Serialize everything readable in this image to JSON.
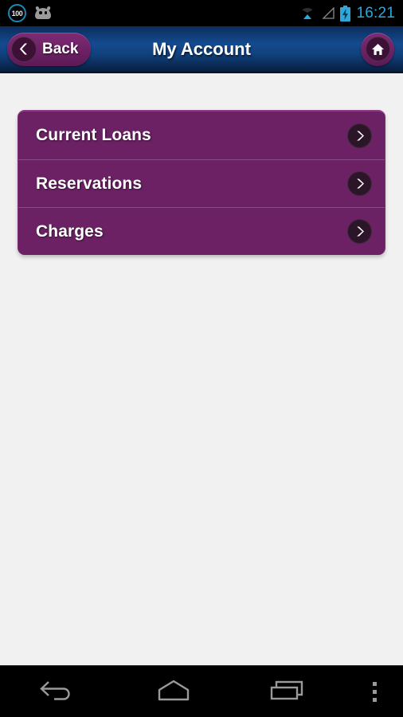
{
  "status_bar": {
    "battery_badge": "100",
    "time": "16:21",
    "icons": {
      "notification_badge": "battery-percent-badge",
      "android_robot": "android-robot-icon",
      "wifi": "wifi-icon",
      "signal": "cell-signal-icon",
      "battery": "battery-charging-icon"
    }
  },
  "header": {
    "title": "My Account",
    "back_label": "Back",
    "back_icon": "chevron-left-icon",
    "home_icon": "home-icon",
    "gradient_from": "#144a8f",
    "gradient_to": "#081d3d"
  },
  "menu": {
    "accent_color": "#6b2164",
    "items": [
      {
        "label": "Current Loans",
        "chevron": "chevron-right-icon"
      },
      {
        "label": "Reservations",
        "chevron": "chevron-right-icon"
      },
      {
        "label": "Charges",
        "chevron": "chevron-right-icon"
      }
    ]
  },
  "nav_bar": {
    "back": "nav-back-icon",
    "home": "nav-home-icon",
    "recents": "nav-recents-icon",
    "overflow": "nav-overflow-icon"
  },
  "colors": {
    "background": "#f1f1f1",
    "status_bar": "#000000",
    "accent_purple": "#6b2164",
    "accent_blue": "#2da8dd"
  }
}
